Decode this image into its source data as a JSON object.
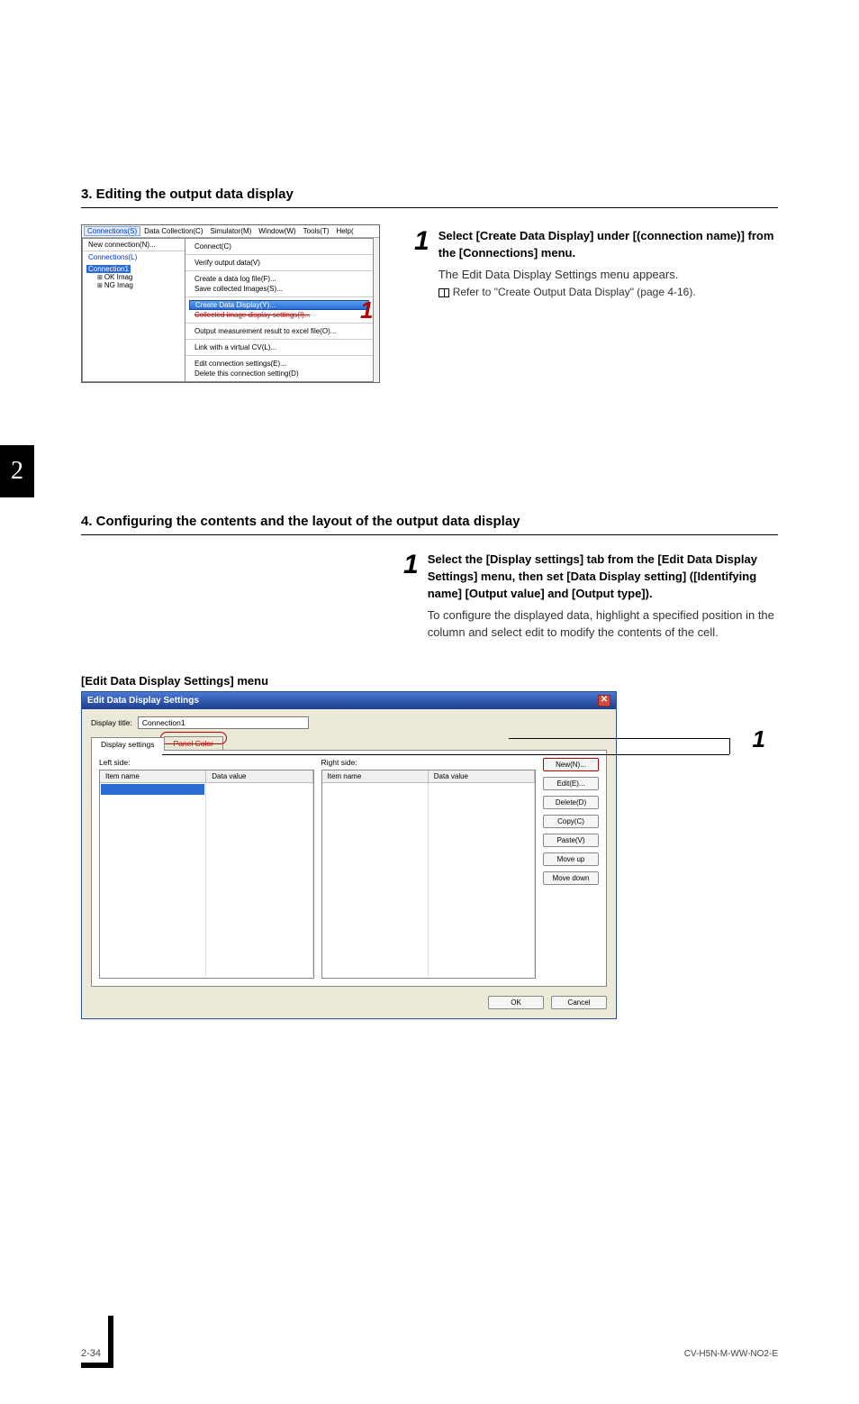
{
  "sideTab": "2",
  "section3": {
    "heading": "3. Editing the output data display",
    "menubar": {
      "items": [
        "Connections(S)",
        "Data Collection(C)",
        "Simulator(M)",
        "Window(W)",
        "Tools(T)",
        "Help("
      ]
    },
    "leftMenu": {
      "newConn": "New connection(N)...",
      "connList": "Connections(L)",
      "selected": "Connection1",
      "treeNodes": [
        "OK Imag",
        "NG Imag"
      ]
    },
    "ctxMenu": {
      "g1": [
        "Connect(C)"
      ],
      "g2": [
        "Verify output data(V)"
      ],
      "g3": [
        "Create a data log file(F)...",
        "Save collected Images(S)..."
      ],
      "g4hl": "Create Data Display(Y)...",
      "g4b": "Collected image display settings(I)...",
      "g5": [
        "Output measurement result to excel file(O)..."
      ],
      "g6": [
        "Link with a virtual CV(L)..."
      ],
      "g7": [
        "Edit connection settings(E)...",
        "Delete this connection setting(D)"
      ]
    },
    "callout": "1",
    "step": {
      "num": "1",
      "bold": "Select [Create Data Display] under [(connection name)] from the [Connections] menu.",
      "line1": "The Edit Data Display Settings menu appears.",
      "ref": "Refer to \"Create Output Data Display\" (page 4-16)."
    }
  },
  "section4": {
    "heading": "4. Configuring the contents and the layout of the output data display",
    "step": {
      "num": "1",
      "bold": "Select the [Display settings] tab from the [Edit Data Display Settings] menu, then set [Data Display setting] ([Identifying name] [Output value] and [Output type]).",
      "body": "To configure the displayed data, highlight a specified position in the column and select edit to modify the contents of the cell."
    },
    "editTitle": "[Edit Data Display Settings] menu",
    "dialog": {
      "title": "Edit Data Display Settings",
      "displayTitleLabel": "Display title:",
      "displayTitleValue": "Connection1",
      "tabs": [
        "Display settings",
        "Panel Color"
      ],
      "leftSide": "Left side:",
      "rightSide": "Right side:",
      "colHeaders": [
        "Item name",
        "Data value"
      ],
      "buttons": [
        "New(N)...",
        "Edit(E)...",
        "Delete(D)",
        "Copy(C)",
        "Paste(V)",
        "Move up",
        "Move down"
      ],
      "ok": "OK",
      "cancel": "Cancel"
    },
    "callout": "1"
  },
  "footer": {
    "page": "2-34",
    "doc": "CV-H5N-M-WW-NO2-E"
  }
}
